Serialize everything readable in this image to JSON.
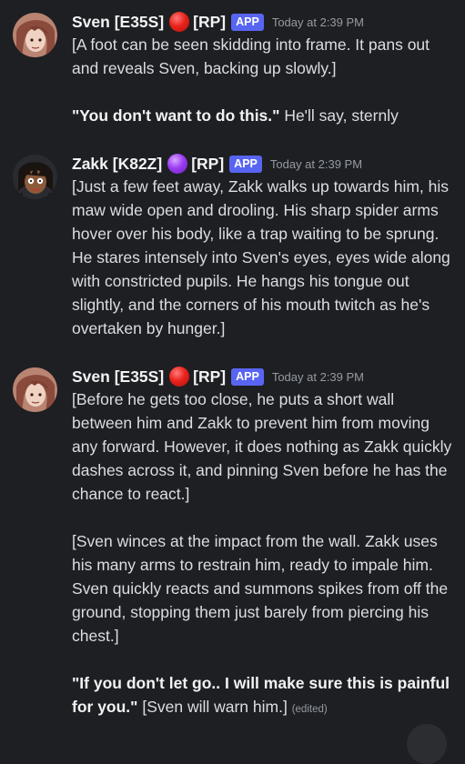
{
  "colors": {
    "background": "#1e1f22",
    "app_badge": "#5865f2",
    "text": "#dbdee1",
    "muted": "#949ba4"
  },
  "messages": [
    {
      "username": "Sven [E35S]",
      "status_icon": "red-circle-icon",
      "tag": "[RP]",
      "badge": "APP",
      "timestamp": "Today at 2:39 PM",
      "paragraphs": [
        {
          "text": "[A foot can be seen skidding into frame. It pans out and reveals Sven, backing up slowly.]"
        },
        {
          "bold": "\"You don't want to do this.\"",
          "text": " He'll say, sternly"
        }
      ]
    },
    {
      "username": "Zakk [K82Z]",
      "status_icon": "purple-circle-icon",
      "tag": "[RP]",
      "badge": "APP",
      "timestamp": "Today at 2:39 PM",
      "paragraphs": [
        {
          "text": "[Just a few feet away, Zakk walks up towards him, his maw wide open and drooling. His sharp spider arms hover over his body, like a trap waiting to be sprung. He stares intensely into Sven's eyes, eyes wide along with constricted pupils. He hangs his tongue out slightly, and the corners of his mouth twitch as he's overtaken by hunger.]"
        }
      ]
    },
    {
      "username": "Sven [E35S]",
      "status_icon": "red-circle-icon",
      "tag": "[RP]",
      "badge": "APP",
      "timestamp": "Today at 2:39 PM",
      "paragraphs": [
        {
          "text": "[Before he gets too close, he puts a short wall between him and Zakk to prevent him from moving any forward. However, it does nothing as Zakk quickly dashes across it, and pinning Sven before he has the chance to react.]"
        },
        {
          "text": "[Sven winces at the impact from the wall. Zakk uses his many arms to restrain him, ready to impale him. Sven quickly reacts and summons spikes from off the ground, stopping them just barely from piercing his chest.]"
        },
        {
          "bold": "\"If you don't let go.. I will make sure this is painful for you.\"",
          "text": " [Sven will warn him.]",
          "edited": "(edited)"
        }
      ]
    }
  ]
}
